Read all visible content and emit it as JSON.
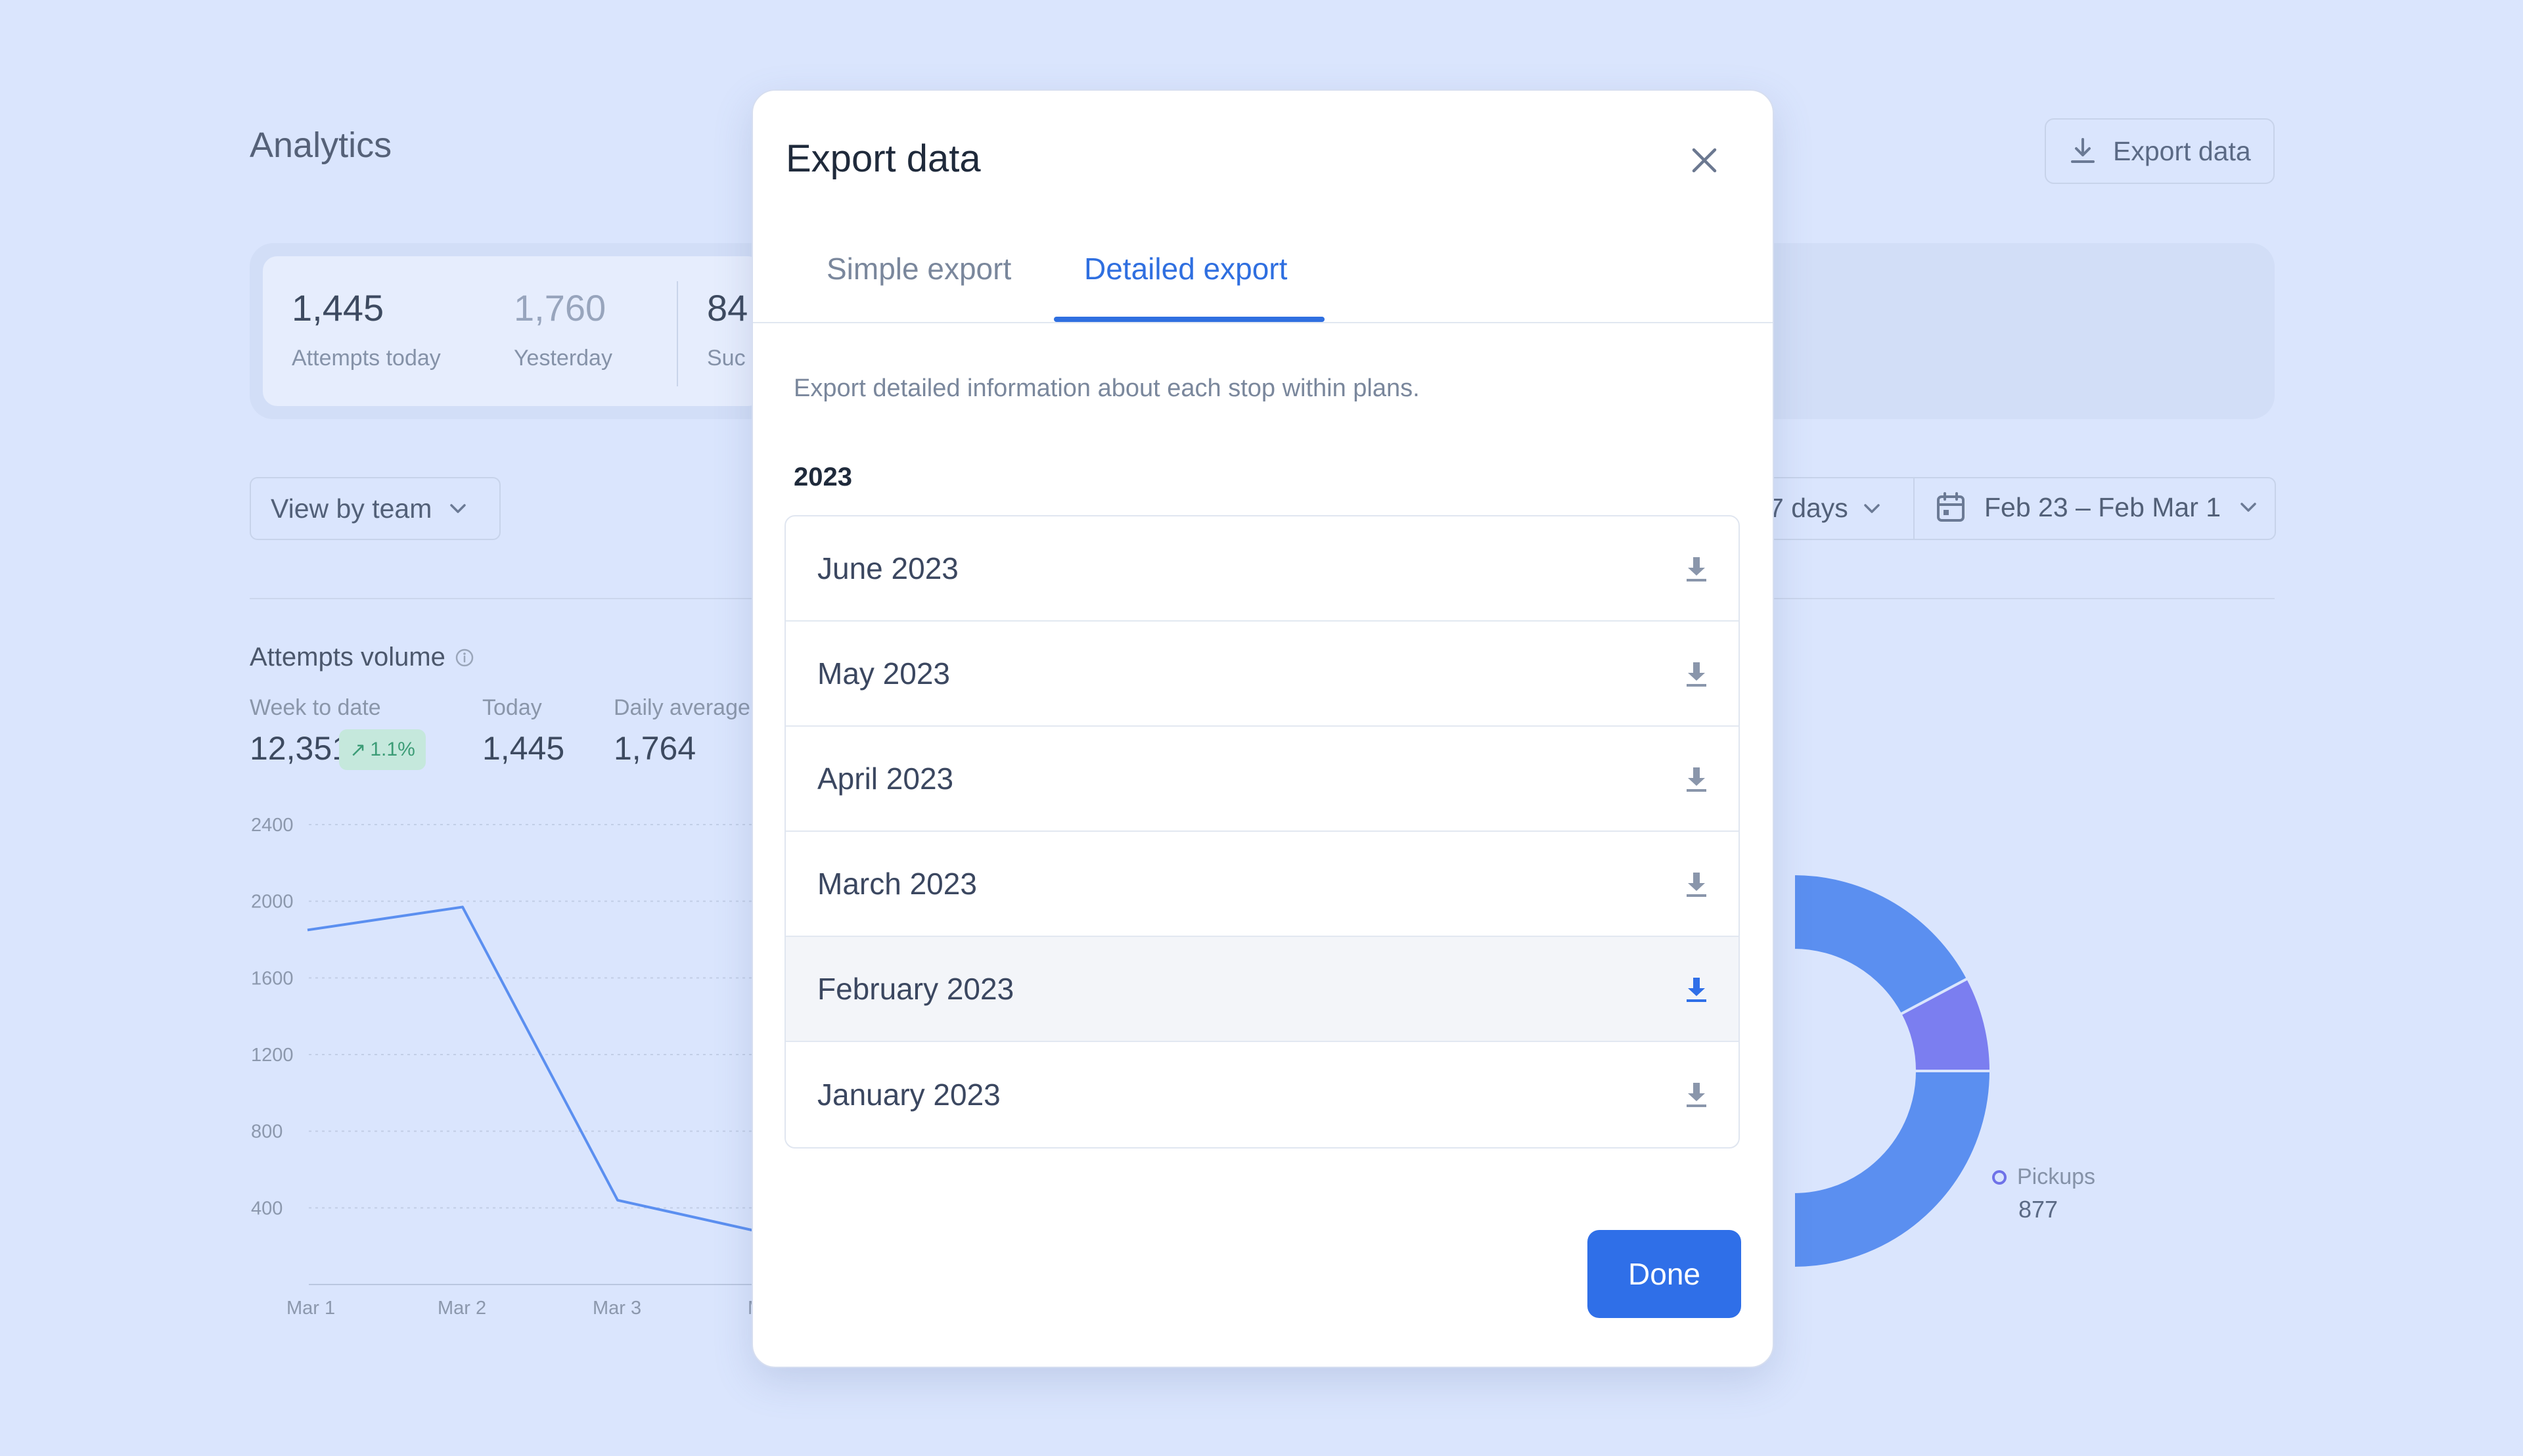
{
  "header": {
    "title": "Analytics",
    "export_label": "Export data"
  },
  "stats": [
    {
      "value": "1,445",
      "label": "Attempts today"
    },
    {
      "value": "1,760",
      "label": "Yesterday"
    },
    {
      "value": "84",
      "label": "Suc"
    }
  ],
  "filters": {
    "team": "View by team",
    "period": "7 days",
    "date_range": "Feb 23 – Feb Mar 1"
  },
  "volume": {
    "title": "Attempts volume",
    "week_label": "Week to date",
    "week_value": "12,351",
    "week_change": "1.1%",
    "today_label": "Today",
    "today_value": "1,445",
    "avg_label": "Daily average",
    "avg_value": "1,764"
  },
  "chart_data": [
    {
      "type": "line",
      "x": [
        "Mar 1",
        "Mar 2",
        "Mar 3",
        "M"
      ],
      "y": [
        1850,
        1970,
        440,
        260
      ],
      "ylim": [
        0,
        2400
      ],
      "yticks": [
        "2400",
        "2000",
        "1600",
        "1200",
        "800",
        "400"
      ],
      "grid": true,
      "color": "#5b8ff0"
    },
    {
      "type": "pie",
      "slices": [
        {
          "name": "Pickups",
          "value": 877,
          "color": "#7b7ef0"
        }
      ],
      "colors": [
        "#5b8ff0",
        "#7b7ef0"
      ]
    }
  ],
  "modal": {
    "title": "Export data",
    "tabs": [
      "Simple export",
      "Detailed export"
    ],
    "active_tab": "Detailed export",
    "description": "Export detailed information about each stop within plans.",
    "year": "2023",
    "months": [
      "June 2023",
      "May 2023",
      "April 2023",
      "March 2023",
      "February 2023",
      "January 2023"
    ],
    "hovered": "February 2023",
    "done_label": "Done",
    "accent": "#2f6fe8"
  }
}
